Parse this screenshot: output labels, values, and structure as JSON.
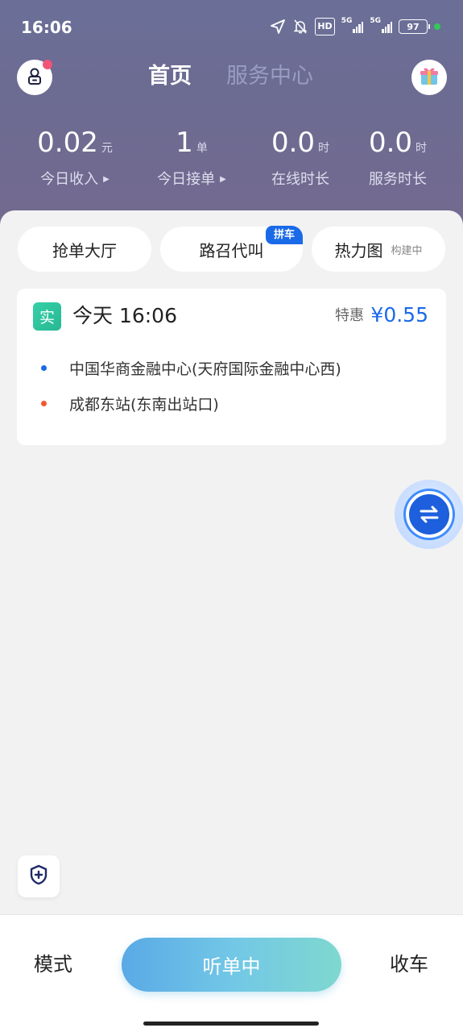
{
  "status_bar": {
    "time": "16:06",
    "hd": "HD",
    "net1": "5G",
    "net2": "5G",
    "battery": "97",
    "icons": [
      "location-arrow-icon",
      "bell-off-icon",
      "hd-icon",
      "signal-5g-icon",
      "signal-5g-icon",
      "battery-icon"
    ],
    "dot_color": "#34c759"
  },
  "header": {
    "tabs": [
      {
        "label": "首页",
        "active": true
      },
      {
        "label": "服务中心",
        "active": false
      }
    ],
    "icons": {
      "left": "lock-user-icon",
      "right": "gift-icon"
    },
    "badge_color": "#f05478"
  },
  "stats": [
    {
      "value": "0.02",
      "unit": "元",
      "label": "今日收入",
      "has_arrow": true
    },
    {
      "value": "1",
      "unit": "单",
      "label": "今日接单",
      "has_arrow": true
    },
    {
      "value": "0.0",
      "unit": "时",
      "label": "在线时长",
      "has_arrow": false
    },
    {
      "value": "0.0",
      "unit": "时",
      "label": "服务时长",
      "has_arrow": false
    }
  ],
  "quick_tabs": {
    "grab": {
      "label": "抢单大厅"
    },
    "road": {
      "label": "路召代叫",
      "badge": "拼车"
    },
    "heat": {
      "label": "热力图",
      "sub": "构建中"
    }
  },
  "order": {
    "tag": "实",
    "time": "今天 16:06",
    "special": "特惠",
    "price": "¥0.55",
    "from": "中国华商金融中心(天府国际金融中心西)",
    "to": "成都东站(东南出站口)",
    "from_color": "#1a6ae8",
    "to_color": "#f0582f"
  },
  "bottom": {
    "mode": "模式",
    "listen": "听单中",
    "close": "收车"
  },
  "colors": {
    "accent": "#1a6ae8",
    "header_bg": "#6b6f97",
    "tag_green": "#2fc49e"
  }
}
